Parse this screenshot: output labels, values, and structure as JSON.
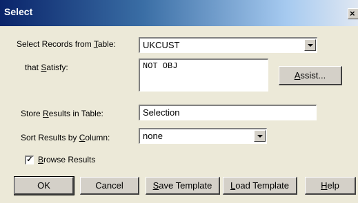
{
  "window": {
    "title": "Select",
    "close_glyph": "×"
  },
  "form": {
    "table_label_pre": "Select Records from ",
    "table_label_key": "T",
    "table_label_post": "able:",
    "table_value": "UKCUST",
    "satisfy_label_pre": "that ",
    "satisfy_label_key": "S",
    "satisfy_label_post": "atisfy:",
    "satisfy_value": "NOT OBJ",
    "assist_pre": "",
    "assist_key": "A",
    "assist_post": "ssist...",
    "store_label_pre": "Store ",
    "store_label_key": "R",
    "store_label_post": "esults in Table:",
    "store_value": "Selection",
    "sort_label_pre": "Sort Results by ",
    "sort_label_key": "C",
    "sort_label_post": "olumn:",
    "sort_value": "none",
    "browse_checked_glyph": "✓",
    "browse_label_pre": "",
    "browse_label_key": "B",
    "browse_label_post": "rowse Results"
  },
  "buttons": {
    "ok": "OK",
    "cancel": "Cancel",
    "save_key": "S",
    "save_post": "ave Template",
    "load_key": "L",
    "load_post": "oad Template",
    "help_key": "H",
    "help_post": "elp"
  }
}
